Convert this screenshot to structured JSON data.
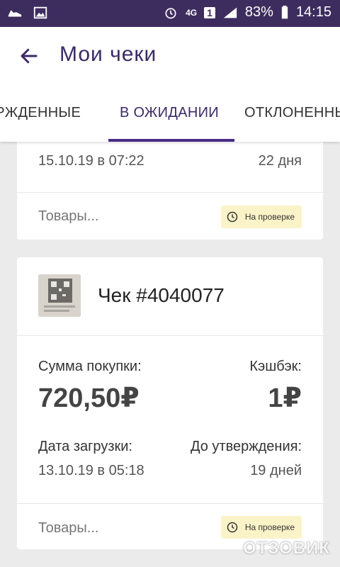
{
  "status_bar": {
    "network": "4G",
    "sim": "1",
    "battery": "83%",
    "time": "14:15",
    "icons": [
      "shoe-icon",
      "image-icon",
      "alarm-icon",
      "signal-icon",
      "battery-icon"
    ]
  },
  "app_bar": {
    "title": "Мои чеки"
  },
  "tabs": [
    {
      "label": "ВЕРЖДЕННЫЕ"
    },
    {
      "label": "В ОЖИДАНИИ",
      "active": true
    },
    {
      "label": "ОТКЛОНЕННЫ"
    }
  ],
  "cards": [
    {
      "date": "15.10.19 в 07:22",
      "days_left": "22 дня",
      "goods": "Товары...",
      "status": "На проверке"
    },
    {
      "check_title": "Чек #4040077",
      "purchase_label": "Сумма покупки:",
      "purchase_value": "720,50₽",
      "cashback_label": "Кэшбэк:",
      "cashback_value": "1₽",
      "upload_label": "Дата загрузки:",
      "upload_date": "13.10.19 в 05:18",
      "approval_label": "До утверждения:",
      "approval_value": "19 дней",
      "goods": "Товары...",
      "status": "На проверке"
    }
  ],
  "watermark": "ОТЗОВИК",
  "colors": {
    "status_bar": "#3d2d5f",
    "accent": "#4b2c87",
    "badge_bg": "#fbf3c8"
  }
}
